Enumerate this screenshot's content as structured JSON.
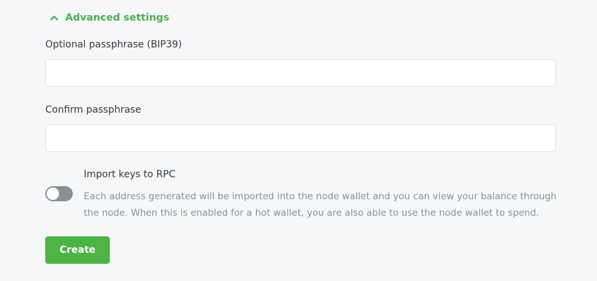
{
  "advanced": {
    "label": "Advanced settings",
    "expanded": true,
    "icon": "chevron-up-icon",
    "color": "#4caf50"
  },
  "passphrase": {
    "label": "Optional passphrase (BIP39)",
    "value": ""
  },
  "confirm": {
    "label": "Confirm passphrase",
    "value": ""
  },
  "rpc": {
    "title": "Import keys to RPC",
    "description": "Each address generated will be imported into the node wallet and you can view your balance through the node. When this is enabled for a hot wallet, you are also able to use the node wallet to spend.",
    "enabled": false
  },
  "create": {
    "label": "Create",
    "color": "#4cb344"
  }
}
